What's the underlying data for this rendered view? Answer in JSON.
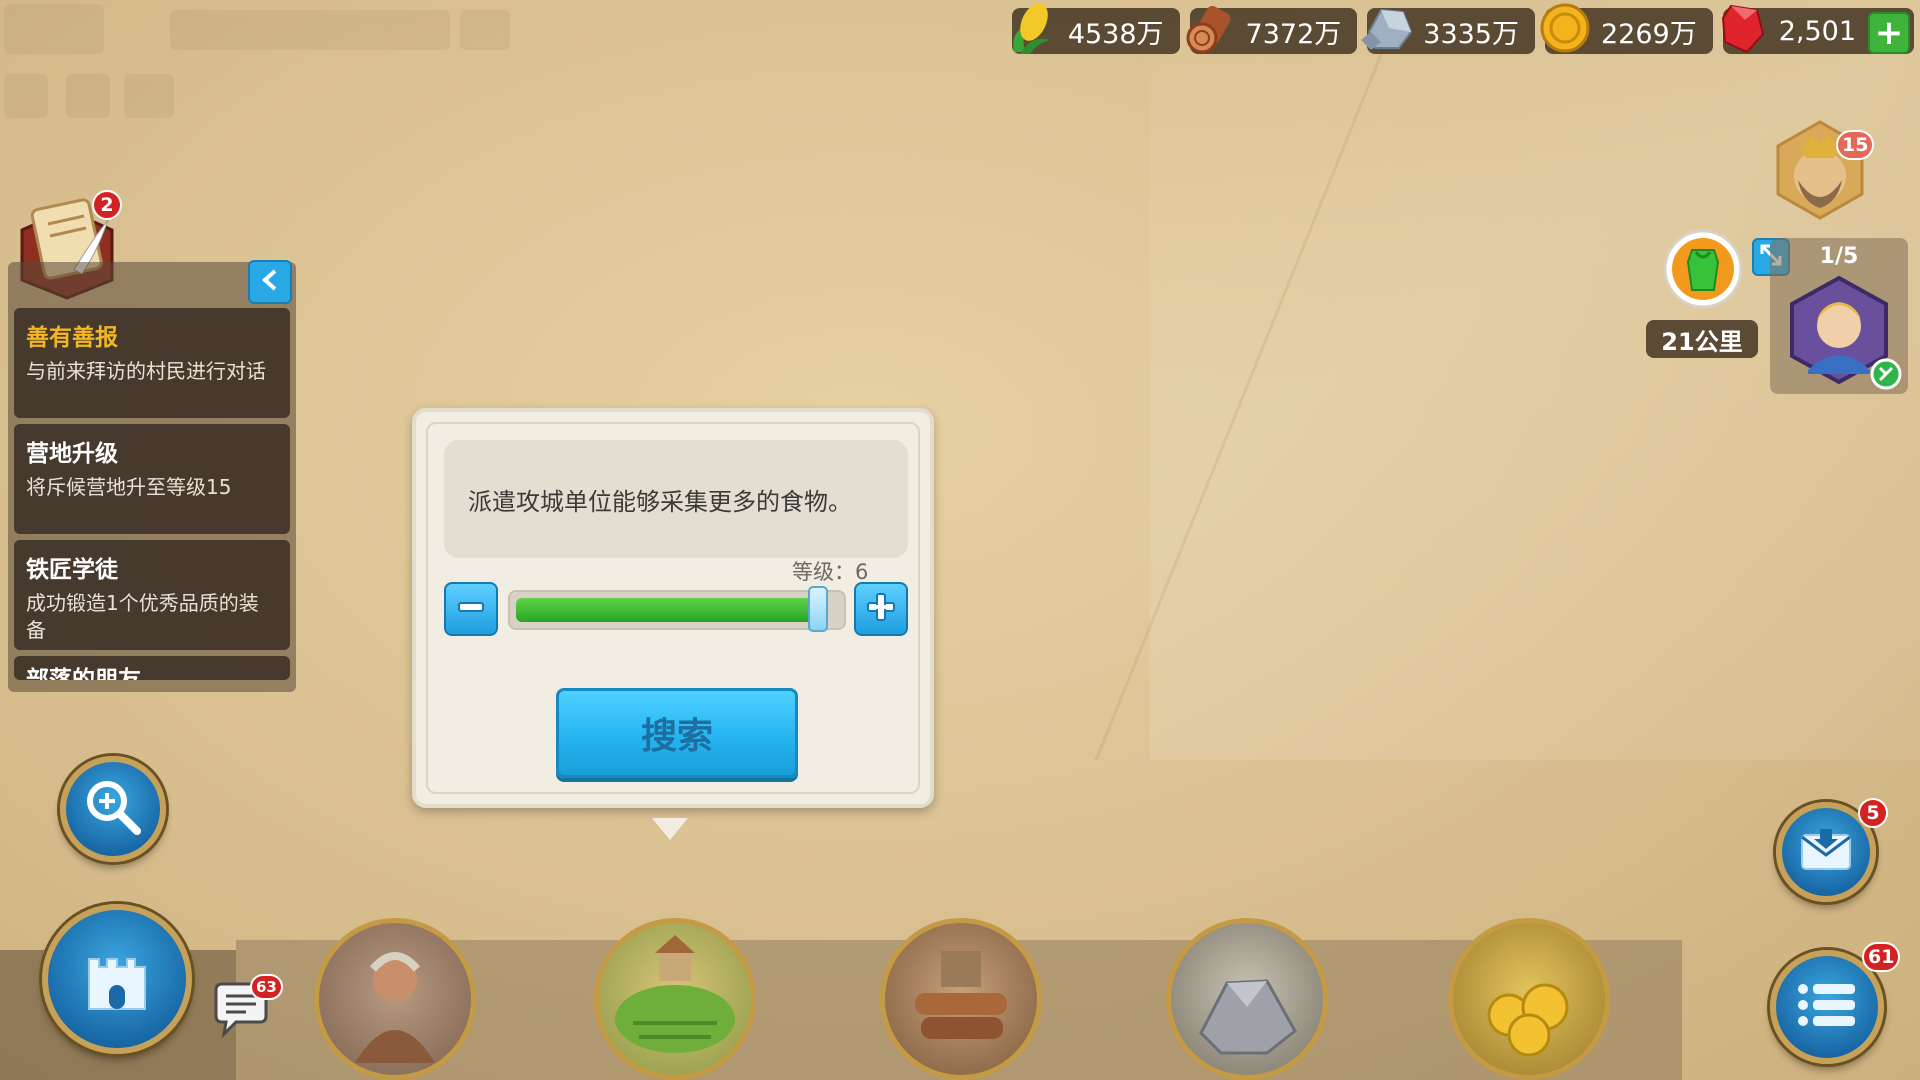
{
  "resources": {
    "food": "4538万",
    "wood": "7372万",
    "stone": "3335万",
    "gold": "2269万",
    "gems": "2,501",
    "add_button": "+"
  },
  "quests": {
    "badge_count": "2",
    "items": [
      {
        "title": "善有善报",
        "desc": "与前来拜访的村民进行对话"
      },
      {
        "title": "营地升级",
        "desc": "将斥候营地升至等级15"
      },
      {
        "title": "铁匠学徒",
        "desc": "成功锻造1个优秀品质的装备"
      },
      {
        "title": "部落的朋友",
        "desc": ""
      }
    ]
  },
  "dialog": {
    "description": "派遣攻城单位能够采集更多的食物。",
    "level_label": "等级：6",
    "level": 6,
    "slider_fill_fraction": 0.98,
    "search_button": "搜索"
  },
  "right_panel": {
    "commander_badge": "15",
    "distance": "21公里",
    "army_count": "1/5"
  },
  "badges": {
    "mail": "5",
    "menu": "61",
    "chat": "63"
  },
  "colors": {
    "accent_blue": "#29a8e6",
    "progress_green": "#3fb43c",
    "quest_highlight": "#f3b625",
    "badge_red": "#d42222"
  }
}
